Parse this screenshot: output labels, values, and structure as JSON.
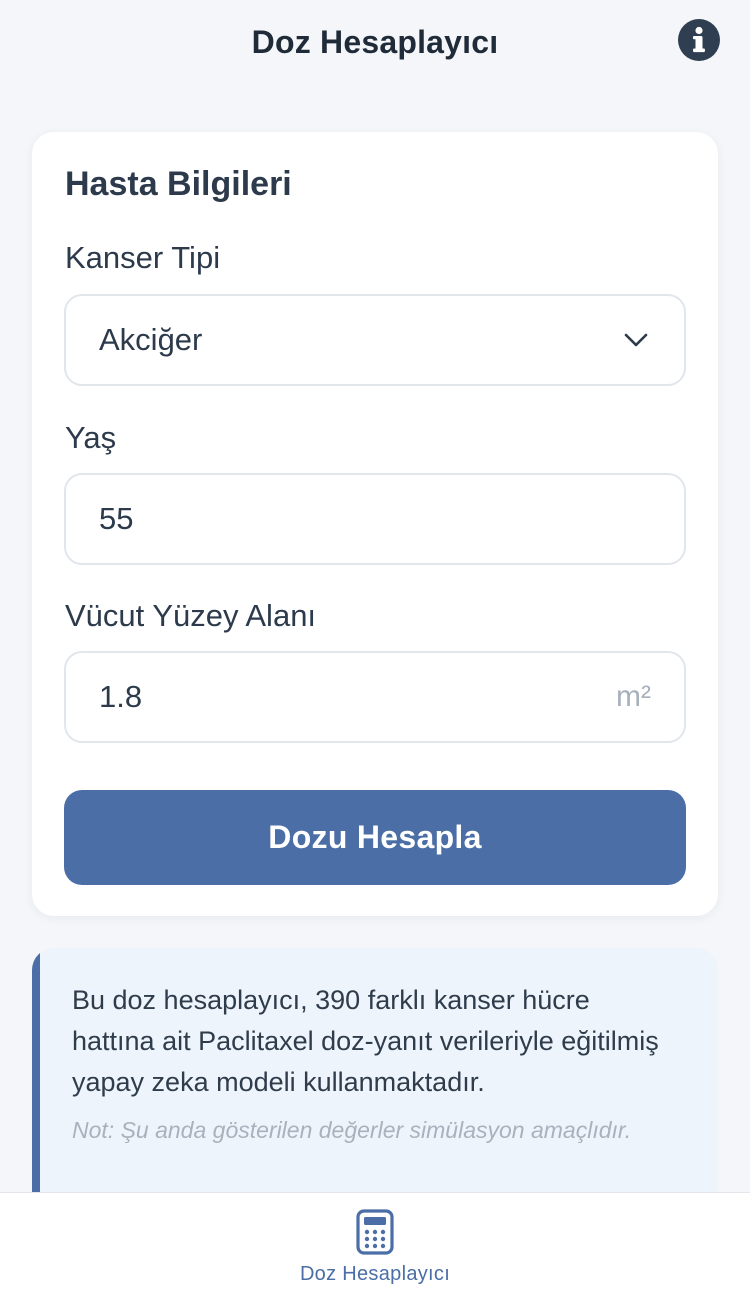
{
  "header": {
    "title": "Doz Hesaplayıcı",
    "info_icon": "info-circle-icon"
  },
  "form": {
    "title": "Hasta Bilgileri",
    "cancer_type": {
      "label": "Kanser Tipi",
      "value": "Akciğer",
      "icon": "chevron-down-icon"
    },
    "age": {
      "label": "Yaş",
      "value": "55"
    },
    "bsa": {
      "label": "Vücut Yüzey Alanı",
      "value": "1.8",
      "unit": "m²"
    },
    "submit_label": "Dozu Hesapla"
  },
  "info": {
    "text": "Bu doz hesaplayıcı, 390 farklı kanser hücre hattına ait Paclitaxel doz-yanıt verileriyle eğitilmiş yapay zeka modeli kullanmaktadır.",
    "note": "Not: Şu anda gösterilen değerler simülasyon amaçlıdır."
  },
  "tabbar": {
    "items": [
      {
        "label": "Doz Hesaplayıcı",
        "icon": "calculator-icon",
        "active": true
      }
    ]
  },
  "colors": {
    "accent": "#4a6ea5",
    "background": "#f4f6f9",
    "card": "#ffffff",
    "info_background": "#eef4fc",
    "text": "#2c3a4b",
    "muted": "#a8b2bd"
  }
}
